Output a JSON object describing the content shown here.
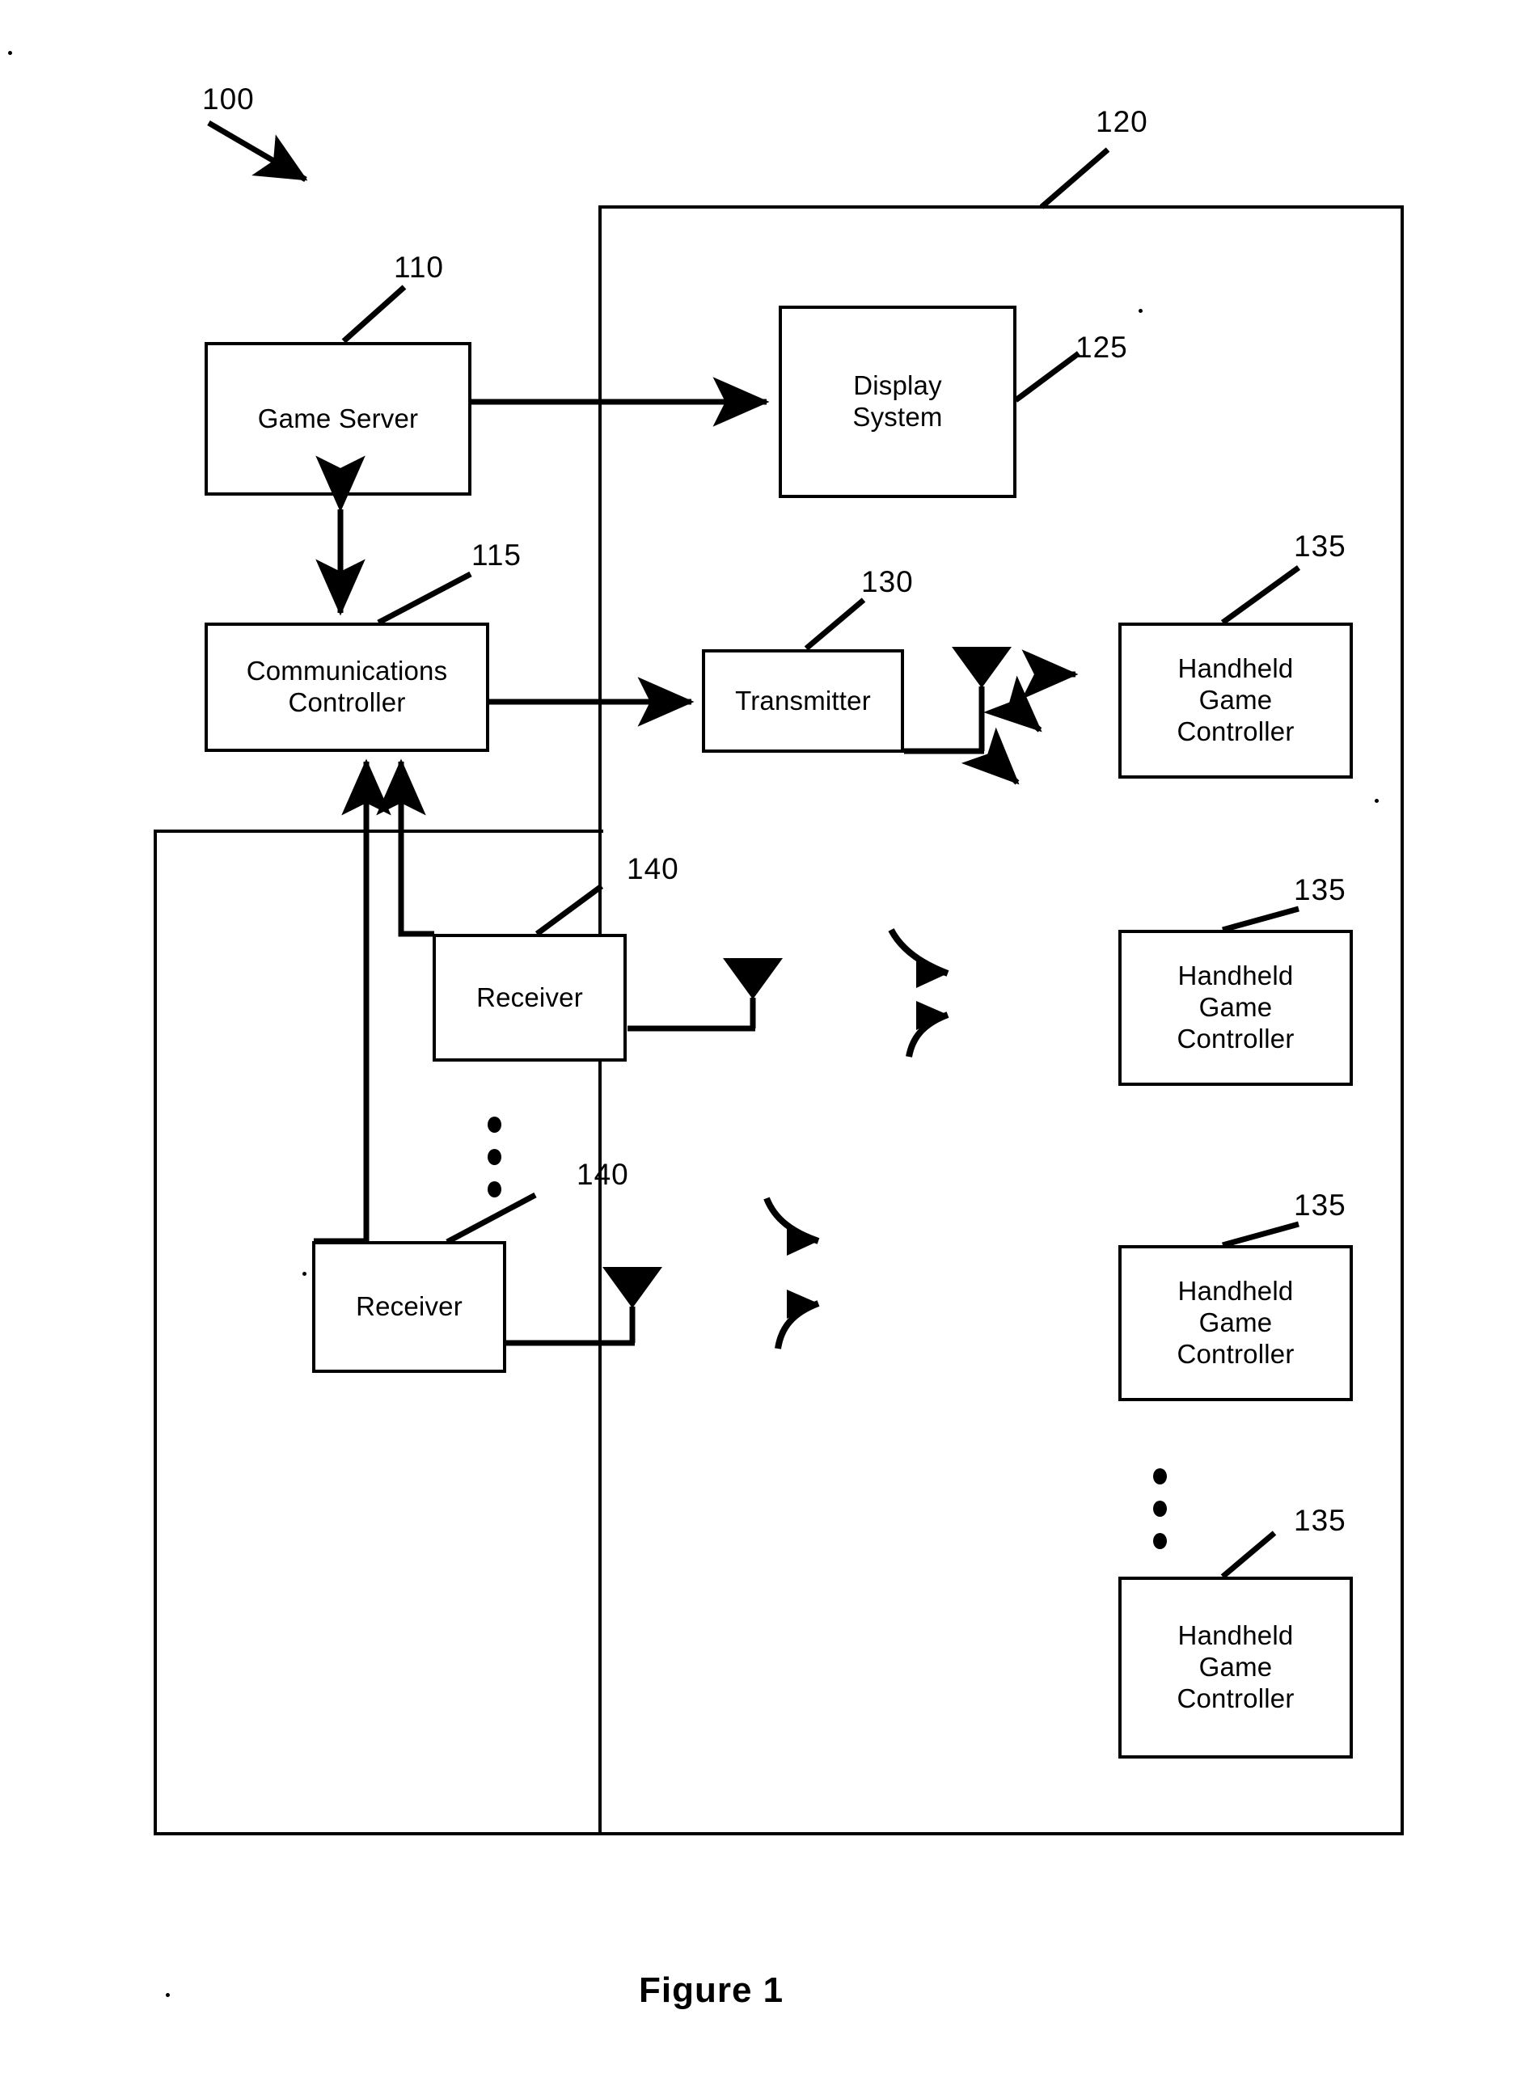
{
  "figure": {
    "caption": "Figure 1",
    "system_ref": "100"
  },
  "blocks": {
    "game_server": {
      "label": "Game Server",
      "ref": "110"
    },
    "communications_controller": {
      "label": "Communications\nController",
      "line1": "Communications",
      "line2": "Controller",
      "ref": "115"
    },
    "display_system": {
      "label": "Display System",
      "line1": "Display",
      "line2": "System",
      "ref": "125"
    },
    "transmitter": {
      "label": "Transmitter",
      "ref": "130"
    },
    "receiver_1": {
      "label": "Receiver",
      "ref": "140"
    },
    "receiver_2": {
      "label": "Receiver",
      "ref": "140"
    },
    "handheld_1": {
      "line1": "Handheld",
      "line2": "Game",
      "line3": "Controller",
      "ref": "135"
    },
    "handheld_2": {
      "line1": "Handheld",
      "line2": "Game",
      "line3": "Controller",
      "ref": "135"
    },
    "handheld_3": {
      "line1": "Handheld",
      "line2": "Game",
      "line3": "Controller",
      "ref": "135"
    },
    "handheld_4": {
      "line1": "Handheld",
      "line2": "Game",
      "line3": "Controller",
      "ref": "135"
    }
  },
  "containers": {
    "venue_enclosure": {
      "ref": "120"
    },
    "receiver_enclosure": {
      "ref": ""
    }
  },
  "colors": {
    "line": "#000000",
    "background": "#ffffff"
  }
}
